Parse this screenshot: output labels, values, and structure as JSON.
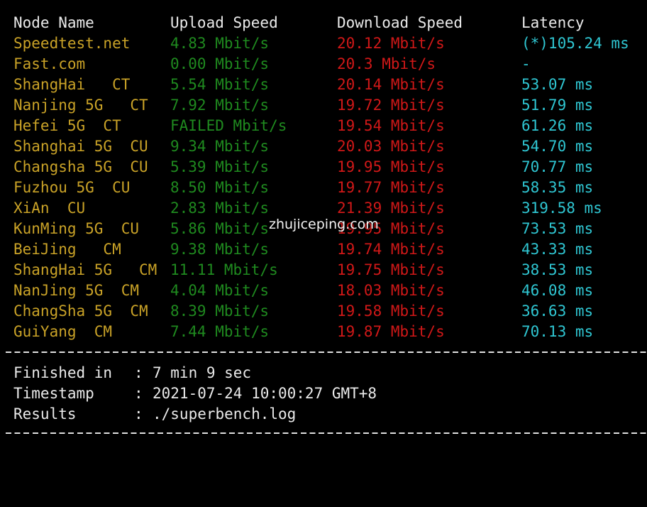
{
  "headers": {
    "node": "Node Name",
    "upload": "Upload Speed",
    "download": "Download Speed",
    "latency": "Latency"
  },
  "rows": [
    {
      "node": "Speedtest.net",
      "upload": "4.83 Mbit/s",
      "download": "20.12 Mbit/s",
      "latency": "(*)105.24 ms"
    },
    {
      "node": "Fast.com",
      "upload": "0.00 Mbit/s",
      "download": "20.3 Mbit/s",
      "latency": "-"
    },
    {
      "node": "ShangHai   CT",
      "upload": "5.54 Mbit/s",
      "download": "20.14 Mbit/s",
      "latency": "53.07 ms"
    },
    {
      "node": "Nanjing 5G   CT",
      "upload": "7.92 Mbit/s",
      "download": "19.72 Mbit/s",
      "latency": "51.79 ms"
    },
    {
      "node": "Hefei 5G  CT",
      "upload": "FAILED Mbit/s",
      "download": "19.54 Mbit/s",
      "latency": "61.26 ms"
    },
    {
      "node": "Shanghai 5G  CU",
      "upload": "9.34 Mbit/s",
      "download": "20.03 Mbit/s",
      "latency": "54.70 ms"
    },
    {
      "node": "Changsha 5G  CU",
      "upload": "5.39 Mbit/s",
      "download": "19.95 Mbit/s",
      "latency": "70.77 ms"
    },
    {
      "node": "Fuzhou 5G  CU",
      "upload": "8.50 Mbit/s",
      "download": "19.77 Mbit/s",
      "latency": "58.35 ms"
    },
    {
      "node": "XiAn  CU",
      "upload": "2.83 Mbit/s",
      "download": "21.39 Mbit/s",
      "latency": "319.58 ms"
    },
    {
      "node": "KunMing 5G  CU",
      "upload": "5.86 Mbit/s",
      "download": "19.95 Mbit/s",
      "latency": "73.53 ms"
    },
    {
      "node": "BeiJing   CM",
      "upload": "9.38 Mbit/s",
      "download": "19.74 Mbit/s",
      "latency": "43.33 ms"
    },
    {
      "node": "ShangHai 5G   CM",
      "upload": "11.11 Mbit/s",
      "download": "19.75 Mbit/s",
      "latency": "38.53 ms"
    },
    {
      "node": "NanJing 5G  CM",
      "upload": "4.04 Mbit/s",
      "download": "18.03 Mbit/s",
      "latency": "46.08 ms"
    },
    {
      "node": "ChangSha 5G  CM",
      "upload": "8.39 Mbit/s",
      "download": "19.58 Mbit/s",
      "latency": "36.63 ms"
    },
    {
      "node": "GuiYang  CM",
      "upload": "7.44 Mbit/s",
      "download": "19.87 Mbit/s",
      "latency": "70.13 ms"
    }
  ],
  "summary": [
    {
      "label": "Finished in",
      "value": "7 min 9 sec"
    },
    {
      "label": "Timestamp",
      "value": "2021-07-24 10:00:27 GMT+8"
    },
    {
      "label": "Results",
      "value": "./superbench.log"
    }
  ],
  "separator": ":",
  "watermark": "zhujiceping.com",
  "colors": {
    "background": "#000000",
    "node": "#c9a227",
    "upload": "#1f8a1f",
    "download": "#d01818",
    "latency": "#2fc6d2",
    "text": "#eaeaea"
  }
}
